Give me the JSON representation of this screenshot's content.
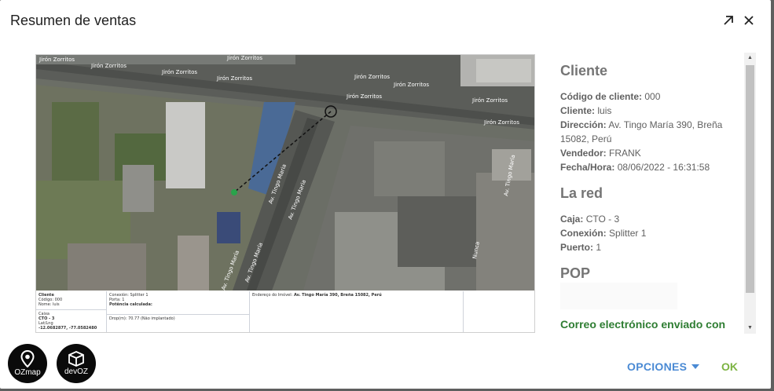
{
  "dialog": {
    "title": "Resumen de ventas"
  },
  "map": {
    "street_labels": [
      "Jirón Zorritos",
      "Jirón Zorritos",
      "Jirón Zorritos",
      "Jirón Zorritos",
      "Jirón Zorritos",
      "Jirón Zorritos",
      "Jirón Zorritos",
      "Jirón Zorritos",
      "Jirón Zorritos",
      "Jirón Zorritos",
      "Av. Tingo Maria",
      "Av. Tingo Maria",
      "Av. Tingo María",
      "Av. Tingo María",
      "Av. Tingo María",
      "Nunca"
    ]
  },
  "receipt": {
    "cliente_h": "Cliente",
    "codigo": "Código: 000",
    "nome": "Nome: luis",
    "caixa_h": "Caixa",
    "caixa": "CTO - 3",
    "latlng_h": "Lat/Lng",
    "latlng": "-12.0682877, -77.0582480",
    "conexion": "Conexión: Splitter 1",
    "porta": "Porta: 1",
    "potencia": "Potência calculada:",
    "drop": "Drop(m): 70.77 (Não implantado)",
    "endereco_k": "Endereço do Imóvel:",
    "endereco_v": "Av. Tingo María 390, Breña 15082, Perú"
  },
  "info": {
    "cliente_title": "Cliente",
    "codigo_k": "Código de cliente:",
    "codigo_v": "000",
    "cliente_k": "Cliente:",
    "cliente_v": "luis",
    "direccion_k": "Dirección:",
    "direccion_v": "Av. Tingo María 390, Breña 15082, Perú",
    "vendedor_k": "Vendedor:",
    "vendedor_v": "FRANK",
    "fecha_k": "Fecha/Hora:",
    "fecha_v": "08/06/2022 - 16:31:58",
    "red_title": "La red",
    "caja_k": "Caja:",
    "caja_v": "CTO - 3",
    "conexion_k": "Conexión:",
    "conexion_v": "Splitter 1",
    "puerto_k": "Puerto:",
    "puerto_v": "1",
    "pop_title": "POP",
    "success": "Correo electrónico enviado con éxito!"
  },
  "footer": {
    "logo1_text": "OZmap",
    "logo2_text": "devOZ",
    "opciones_label": "OPCIONES",
    "ok_label": "OK"
  },
  "colors": {
    "accent": "#4a8ad4",
    "ok": "#7cb342",
    "success": "#2e7d32"
  }
}
